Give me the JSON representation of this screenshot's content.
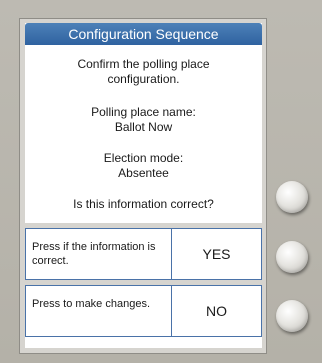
{
  "screen": {
    "title": "Configuration Sequence",
    "confirm_text": "Confirm the polling place configuration.",
    "polling_label": "Polling place name:",
    "polling_value": "Ballot Now",
    "mode_label": "Election mode:",
    "mode_value": "Absentee",
    "question": "Is this information correct?"
  },
  "options": [
    {
      "hint": "Press if the information is correct.",
      "answer": "YES"
    },
    {
      "hint": "Press to make changes.",
      "answer": "NO"
    }
  ],
  "hardware_buttons": [
    "unlabeled",
    "yes",
    "no"
  ],
  "colors": {
    "title_bar": "#2f62a0",
    "border": "#4a72a8",
    "bezel": "#b9b6ad"
  }
}
